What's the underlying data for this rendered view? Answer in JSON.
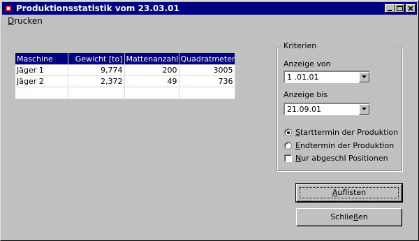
{
  "window": {
    "title": "Produktionsstatistik vom 23.03.01"
  },
  "menu": {
    "drucken": {
      "mnemonic": "D",
      "rest": "rucken"
    }
  },
  "table": {
    "columns": [
      "Maschine",
      "Gewicht [to]",
      "Mattenanzahl",
      "Quadratmeter"
    ],
    "rows": [
      [
        "Jäger 1",
        "9,774",
        "200",
        "3005"
      ],
      [
        "Jäger 2",
        "2,372",
        "49",
        "736"
      ],
      [
        "",
        "",
        "",
        ""
      ]
    ]
  },
  "criteria": {
    "group_title": "Kriterien",
    "anzeige_von_label": "Anzeige von",
    "anzeige_von_value": "1 .01.01",
    "anzeige_bis_label": "Anzeige bis",
    "anzeige_bis_value": "21.09.01",
    "radio_start": {
      "mnemonic": "S",
      "rest": "tarttermin der Produktion",
      "checked": true
    },
    "radio_end": {
      "mnemonic": "E",
      "rest": "ndtermin der Produktion",
      "checked": false
    },
    "checkbox_nur": {
      "mnemonic": "N",
      "rest": "ur abgeschl Positionen",
      "checked": false
    }
  },
  "buttons": {
    "auflisten": {
      "mnemonic": "A",
      "rest": "uflisten"
    },
    "schliessen": {
      "pre": "Schlie",
      "mnemonic": "ß",
      "rest": "en"
    }
  },
  "colors": {
    "titlebar": "#000080",
    "face": "#c0c0c0",
    "header": "#000080"
  }
}
